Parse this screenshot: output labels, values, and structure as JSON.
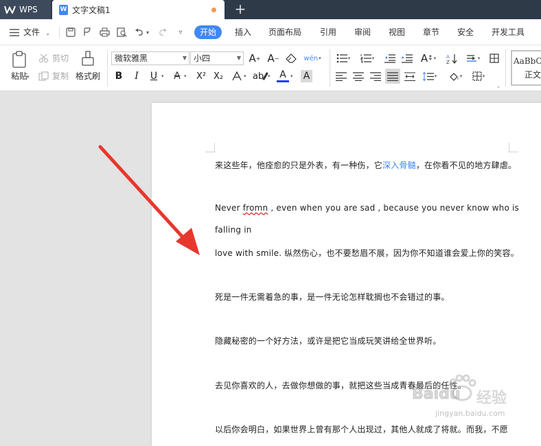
{
  "tabs": {
    "app_label": "WPS",
    "doc_title": "文字文稿1",
    "doc_icon_letter": "W",
    "new_tab": "+"
  },
  "menu": {
    "file_label": "文件",
    "items": [
      "开始",
      "插入",
      "页面布局",
      "引用",
      "审阅",
      "视图",
      "章节",
      "安全",
      "开发工具"
    ],
    "active_index": 0
  },
  "ribbon": {
    "paste": "粘贴",
    "cut": "剪切",
    "copy": "复制",
    "format_painter": "格式刷",
    "font_family": "微软雅黑",
    "font_size": "小四",
    "bold": "B",
    "italic": "I",
    "underline": "U",
    "superscript": "X²",
    "subscript": "X₂",
    "style_preview": "AaBbCc",
    "style_name": "正文"
  },
  "document": {
    "p1_before": "来这些年，他痊愈的只是外表，有一种伤，它",
    "p1_link": "深入骨髓",
    "p1_after": "，在你看不见的地方肆虐。",
    "p2a_before": "Never ",
    "p2a_misspelled": "fromn",
    "p2a_after": " , even when you are sad , because you never know who is",
    "p2b": "falling in",
    "p2c": "love with smile. 纵然伤心，也不要愁眉不展，因为你不知道谁会爱上你的笑容。",
    "p3": "死是一件无需着急的事，是一件无论怎样耽搁也不会错过的事。",
    "p4": "隐藏秘密的一个好方法，或许是把它当成玩笑讲给全世界听。",
    "p5": "去见你喜欢的人，去做你想做的事，就把这些当成青春最后的任性。",
    "p6": "以后你会明白，如果世界上曾有那个人出现过，其他人就成了将就。而我，不愿"
  },
  "watermark": {
    "brand": "Baidu",
    "brand_cn": "经验",
    "url": "jingyan.baidu.com"
  },
  "colors": {
    "accent": "#3f88f1",
    "tabbar": "#2f3a49",
    "arrow": "#e8372c"
  }
}
